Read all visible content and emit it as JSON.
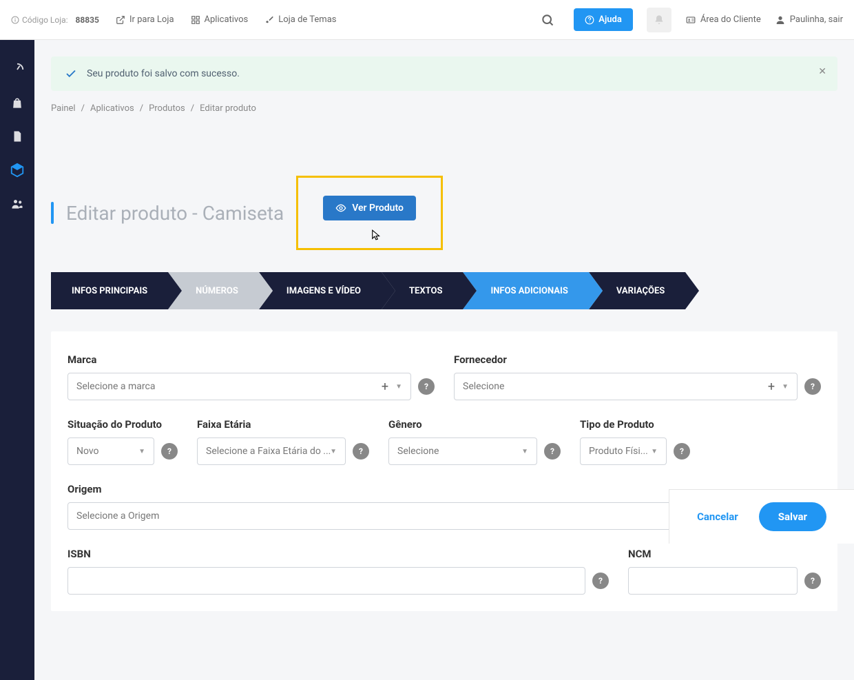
{
  "topbar": {
    "storeCodeLabel": "Código Loja:",
    "storeCode": "88835",
    "links": {
      "store": "Ir para Loja",
      "apps": "Aplicativos",
      "themes": "Loja de Temas"
    },
    "helpLabel": "Ajuda",
    "clientArea": "Área do Cliente",
    "userLogout": "Paulinha, sair"
  },
  "alert": {
    "message": "Seu produto foi salvo com sucesso."
  },
  "breadcrumb": {
    "items": [
      "Painel",
      "Aplicativos",
      "Produtos",
      "Editar produto"
    ]
  },
  "pageTitle": "Editar produto - Camiseta",
  "viewProductLabel": "Ver Produto",
  "steps": [
    "INFOS PRINCIPAIS",
    "NÚMEROS",
    "IMAGENS E VÍDEO",
    "TEXTOS",
    "INFOS ADICIONAIS",
    "VARIAÇÕES"
  ],
  "form": {
    "brand": {
      "label": "Marca",
      "placeholder": "Selecione a marca"
    },
    "supplier": {
      "label": "Fornecedor",
      "placeholder": "Selecione"
    },
    "status": {
      "label": "Situação do Produto",
      "value": "Novo"
    },
    "ageRange": {
      "label": "Faixa Etária",
      "placeholder": "Selecione a Faixa Etária do ..."
    },
    "gender": {
      "label": "Gênero",
      "placeholder": "Selecione"
    },
    "productType": {
      "label": "Tipo de Produto",
      "value": "Produto Físi..."
    },
    "origin": {
      "label": "Origem",
      "placeholder": "Selecione a Origem"
    },
    "isbn": {
      "label": "ISBN"
    },
    "ncm": {
      "label": "NCM"
    }
  },
  "footer": {
    "cancel": "Cancelar",
    "save": "Salvar"
  }
}
